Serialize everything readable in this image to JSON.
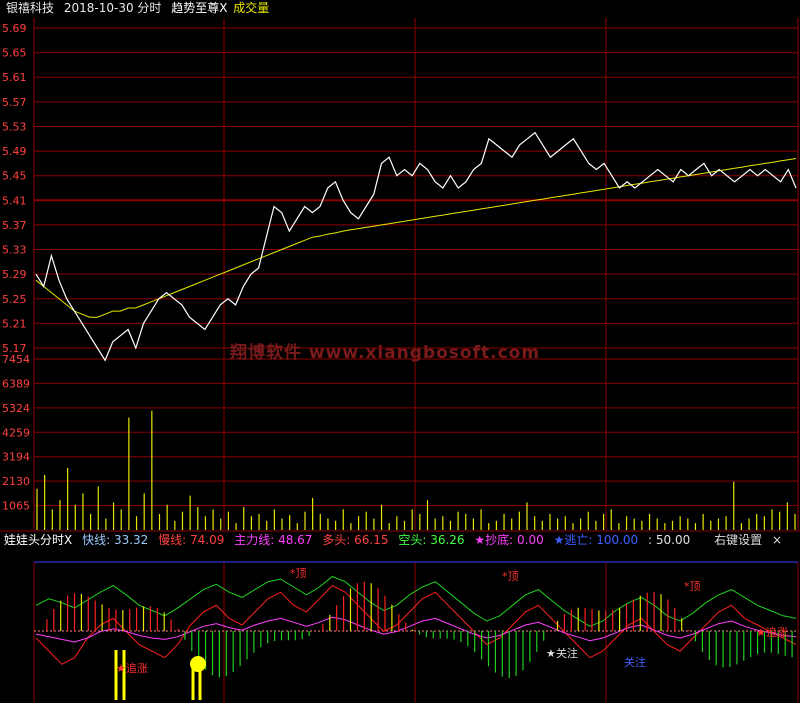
{
  "header": {
    "stock_name": "银禧科技",
    "date_label": "2018-10-30 分时",
    "indicator_name": "趋势至尊X",
    "volume_label": "成交量"
  },
  "watermark": "翔博软件 www.xiangbosoft.com",
  "indicator_panel": {
    "title": "娃娃头分时X",
    "fast_label": "快线:",
    "fast_value": "33.32",
    "slow_label": "慢线:",
    "slow_value": "74.09",
    "main_label": "主力线:",
    "main_value": "48.67",
    "long_label": "多头:",
    "long_value": "66.15",
    "short_label": "空头:",
    "short_value": "36.26",
    "bottom_label": "★抄底:",
    "bottom_value": "0.00",
    "escape_label": "★逃亡:",
    "escape_value": "100.00",
    "extra_value": ": 50.00",
    "settings_label": "右键设置",
    "close_glyph": "×"
  },
  "annotations": {
    "chase_up": "★追涨",
    "top": "*顶",
    "watch": "★关注",
    "watch2": "关注"
  },
  "colors": {
    "red_grid": "#8b0000",
    "price_line": "#ffffff",
    "avg_line": "#e8e800",
    "fast_line": "#ff2020",
    "slow_line": "#2030ff",
    "green_line": "#20d020",
    "magenta": "#ff40ff"
  },
  "chart_data": {
    "type": "line",
    "price_axis_ticks": [
      "5.69",
      "5.65",
      "5.61",
      "5.57",
      "5.53",
      "5.49",
      "5.45",
      "5.41",
      "5.37",
      "5.33",
      "5.29",
      "5.25",
      "5.21",
      "5.17"
    ],
    "ylim": [
      5.15,
      5.69
    ],
    "prev_close": 5.41,
    "volume_axis_ticks": [
      "7454",
      "6389",
      "5324",
      "4259",
      "3194",
      "2130",
      "1065"
    ],
    "volume_ylim": [
      0,
      7454
    ],
    "price_series": [
      5.29,
      5.27,
      5.32,
      5.28,
      5.25,
      5.23,
      5.21,
      5.19,
      5.17,
      5.15,
      5.18,
      5.19,
      5.2,
      5.17,
      5.21,
      5.23,
      5.25,
      5.26,
      5.25,
      5.24,
      5.22,
      5.21,
      5.2,
      5.22,
      5.24,
      5.25,
      5.24,
      5.27,
      5.29,
      5.3,
      5.35,
      5.4,
      5.39,
      5.36,
      5.38,
      5.4,
      5.39,
      5.4,
      5.43,
      5.44,
      5.41,
      5.39,
      5.38,
      5.4,
      5.42,
      5.47,
      5.48,
      5.45,
      5.46,
      5.45,
      5.47,
      5.46,
      5.44,
      5.43,
      5.45,
      5.43,
      5.44,
      5.46,
      5.47,
      5.51,
      5.5,
      5.49,
      5.48,
      5.5,
      5.51,
      5.52,
      5.5,
      5.48,
      5.49,
      5.5,
      5.51,
      5.49,
      5.47,
      5.46,
      5.47,
      5.45,
      5.43,
      5.44,
      5.43,
      5.44,
      5.45,
      5.46,
      5.45,
      5.44,
      5.46,
      5.45,
      5.46,
      5.47,
      5.45,
      5.46,
      5.45,
      5.44,
      5.45,
      5.46,
      5.45,
      5.46,
      5.45,
      5.44,
      5.46,
      5.43
    ],
    "avg_series": [
      5.28,
      5.27,
      5.26,
      5.25,
      5.24,
      5.23,
      5.225,
      5.22,
      5.22,
      5.225,
      5.23,
      5.23,
      5.235,
      5.235,
      5.24,
      5.245,
      5.25,
      5.255,
      5.26,
      5.265,
      5.27,
      5.275,
      5.28,
      5.285,
      5.29,
      5.295,
      5.3,
      5.305,
      5.31,
      5.315,
      5.32,
      5.325,
      5.33,
      5.335,
      5.34,
      5.345,
      5.35,
      5.352,
      5.355,
      5.357,
      5.36,
      5.362,
      5.364,
      5.366,
      5.368,
      5.37,
      5.372,
      5.374,
      5.376,
      5.378,
      5.38,
      5.382,
      5.384,
      5.386,
      5.388,
      5.39,
      5.392,
      5.394,
      5.396,
      5.398,
      5.4,
      5.402,
      5.404,
      5.406,
      5.408,
      5.41,
      5.412,
      5.414,
      5.416,
      5.418,
      5.42,
      5.422,
      5.424,
      5.426,
      5.428,
      5.43,
      5.432,
      5.434,
      5.436,
      5.438,
      5.44,
      5.442,
      5.444,
      5.446,
      5.448,
      5.45,
      5.452,
      5.454,
      5.456,
      5.458,
      5.46,
      5.462,
      5.464,
      5.466,
      5.468,
      5.47,
      5.472,
      5.474,
      5.476,
      5.478
    ],
    "volume_series": [
      1800,
      2400,
      900,
      1300,
      2700,
      1100,
      1600,
      700,
      1900,
      500,
      1200,
      900,
      4900,
      600,
      1600,
      5200,
      700,
      1100,
      400,
      800,
      1500,
      1000,
      600,
      900,
      500,
      800,
      300,
      1000,
      600,
      700,
      400,
      900,
      500,
      650,
      300,
      800,
      1400,
      700,
      500,
      400,
      900,
      300,
      600,
      800,
      500,
      1100,
      300,
      600,
      400,
      900,
      700,
      1300,
      500,
      600,
      400,
      800,
      700,
      500,
      900,
      300,
      400,
      700,
      500,
      800,
      1200,
      600,
      400,
      700,
      500,
      600,
      300,
      500,
      800,
      400,
      700,
      900,
      300,
      600,
      500,
      400,
      700,
      500,
      300,
      400,
      600,
      500,
      300,
      700,
      400,
      500,
      600,
      2100,
      300,
      500,
      700,
      600,
      900,
      800,
      1200,
      700
    ],
    "indicator_series": [
      {
        "name": "快线",
        "values": [
          45,
          35,
          25,
          30,
          45,
          55,
          60,
          50,
          40,
          35,
          30,
          40,
          55,
          65,
          70,
          60,
          55,
          65,
          75,
          80,
          70,
          65,
          75,
          85,
          80,
          70,
          60,
          50,
          55,
          65,
          75,
          80,
          70,
          60,
          50,
          40,
          45,
          55,
          65,
          70,
          60,
          50,
          40,
          30,
          35,
          45,
          55,
          60,
          50,
          40,
          35,
          45,
          55,
          65,
          70,
          60,
          55,
          50,
          45,
          40
        ]
      },
      {
        "name": "慢线",
        "values": [
          70,
          75,
          72,
          68,
          74,
          80,
          85,
          78,
          70,
          66,
          62,
          68,
          75,
          82,
          86,
          80,
          76,
          82,
          88,
          90,
          84,
          78,
          84,
          92,
          88,
          80,
          72,
          66,
          70,
          78,
          84,
          88,
          80,
          72,
          64,
          58,
          62,
          70,
          78,
          82,
          74,
          66,
          60,
          54,
          58,
          66,
          72,
          76,
          70,
          62,
          58,
          64,
          72,
          78,
          82,
          76,
          70,
          66,
          62,
          60
        ]
      },
      {
        "name": "主力线",
        "values": [
          48,
          46,
          44,
          42,
          45,
          50,
          52,
          50,
          47,
          45,
          44,
          46,
          50,
          54,
          56,
          53,
          51,
          55,
          58,
          60,
          57,
          54,
          57,
          61,
          59,
          55,
          51,
          48,
          50,
          54,
          58,
          60,
          56,
          52,
          48,
          45,
          47,
          51,
          55,
          57,
          53,
          49,
          46,
          43,
          45,
          49,
          53,
          55,
          51,
          47,
          45,
          48,
          52,
          56,
          58,
          54,
          51,
          49,
          47,
          46
        ]
      }
    ]
  }
}
